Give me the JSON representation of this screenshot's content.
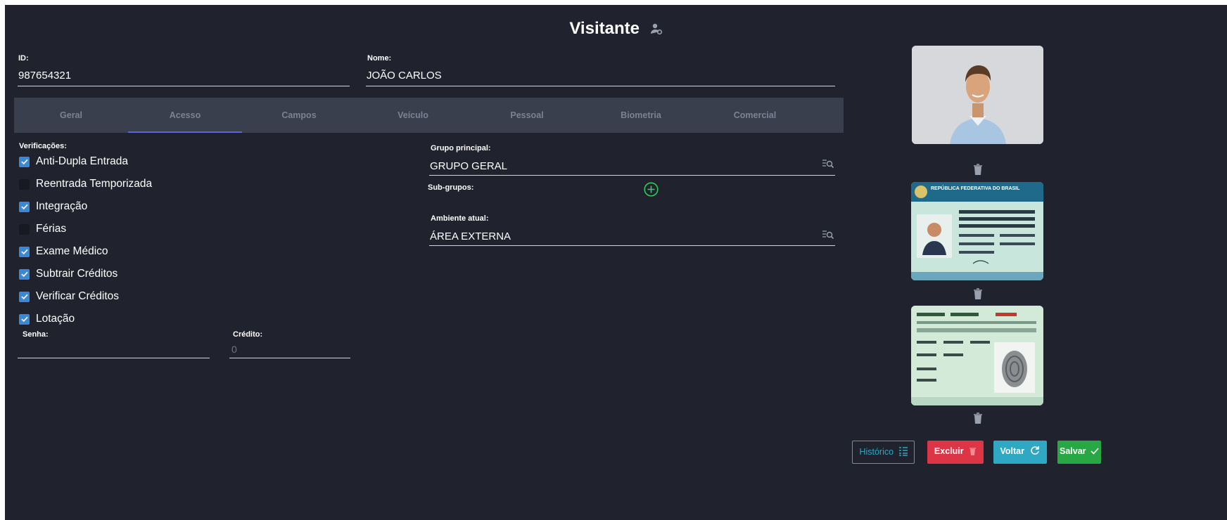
{
  "header": {
    "title": "Visitante",
    "title_icon": "user-gear-icon"
  },
  "fields": {
    "id": {
      "label": "ID:",
      "value": "987654321"
    },
    "nome": {
      "label": "Nome:",
      "value": "JOÃO CARLOS"
    }
  },
  "tabs": [
    {
      "label": "Geral",
      "active": false
    },
    {
      "label": "Acesso",
      "active": true
    },
    {
      "label": "Campos",
      "active": false
    },
    {
      "label": "Veículo",
      "active": false
    },
    {
      "label": "Pessoal",
      "active": false
    },
    {
      "label": "Biometria",
      "active": false
    },
    {
      "label": "Comercial",
      "active": false
    }
  ],
  "verificacoes": {
    "label": "Verificações:",
    "items": [
      {
        "label": "Anti-Dupla Entrada",
        "checked": true
      },
      {
        "label": "Reentrada Temporizada",
        "checked": false
      },
      {
        "label": "Integração",
        "checked": true
      },
      {
        "label": "Férias",
        "checked": false
      },
      {
        "label": "Exame Médico",
        "checked": true
      },
      {
        "label": "Subtrair Créditos",
        "checked": true
      },
      {
        "label": "Verificar Créditos",
        "checked": true
      },
      {
        "label": "Lotação",
        "checked": true
      }
    ]
  },
  "senha": {
    "label": "Senha:",
    "value": ""
  },
  "credito": {
    "label": "Crédito:",
    "placeholder": "0"
  },
  "grupo_principal": {
    "label": "Grupo principal:",
    "value": "GRUPO GERAL"
  },
  "sub_grupos": {
    "label": "Sub-grupos:"
  },
  "ambiente_atual": {
    "label": "Ambiente atual:",
    "value": "ÁREA EXTERNA"
  },
  "id_card": {
    "title": "REPÚBLICA FEDERATIVA DO BRASIL"
  },
  "buttons": {
    "historico": "Histórico",
    "excluir": "Excluir",
    "voltar": "Voltar",
    "salvar": "Salvar"
  },
  "colors": {
    "background": "#20222e",
    "tab_bar": "#3a3f4e",
    "checkbox": "#3d88d6",
    "historico": "#2fa8c4",
    "excluir": "#dc3545",
    "voltar": "#2fa8c4",
    "salvar": "#28a745",
    "add_icon": "#2fd35a"
  }
}
